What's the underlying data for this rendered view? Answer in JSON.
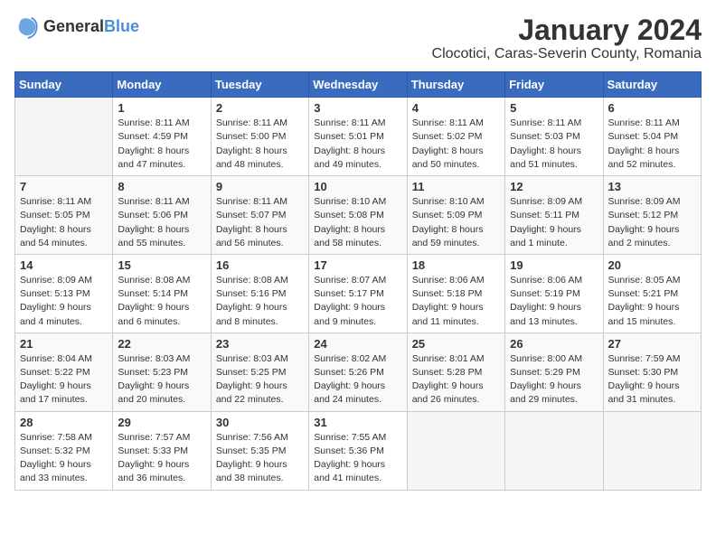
{
  "logo": {
    "general": "General",
    "blue": "Blue"
  },
  "header": {
    "month_year": "January 2024",
    "location": "Clocotici, Caras-Severin County, Romania"
  },
  "weekdays": [
    "Sunday",
    "Monday",
    "Tuesday",
    "Wednesday",
    "Thursday",
    "Friday",
    "Saturday"
  ],
  "weeks": [
    [
      {
        "day": "",
        "info": ""
      },
      {
        "day": "1",
        "info": "Sunrise: 8:11 AM\nSunset: 4:59 PM\nDaylight: 8 hours\nand 47 minutes."
      },
      {
        "day": "2",
        "info": "Sunrise: 8:11 AM\nSunset: 5:00 PM\nDaylight: 8 hours\nand 48 minutes."
      },
      {
        "day": "3",
        "info": "Sunrise: 8:11 AM\nSunset: 5:01 PM\nDaylight: 8 hours\nand 49 minutes."
      },
      {
        "day": "4",
        "info": "Sunrise: 8:11 AM\nSunset: 5:02 PM\nDaylight: 8 hours\nand 50 minutes."
      },
      {
        "day": "5",
        "info": "Sunrise: 8:11 AM\nSunset: 5:03 PM\nDaylight: 8 hours\nand 51 minutes."
      },
      {
        "day": "6",
        "info": "Sunrise: 8:11 AM\nSunset: 5:04 PM\nDaylight: 8 hours\nand 52 minutes."
      }
    ],
    [
      {
        "day": "7",
        "info": "Sunrise: 8:11 AM\nSunset: 5:05 PM\nDaylight: 8 hours\nand 54 minutes."
      },
      {
        "day": "8",
        "info": "Sunrise: 8:11 AM\nSunset: 5:06 PM\nDaylight: 8 hours\nand 55 minutes."
      },
      {
        "day": "9",
        "info": "Sunrise: 8:11 AM\nSunset: 5:07 PM\nDaylight: 8 hours\nand 56 minutes."
      },
      {
        "day": "10",
        "info": "Sunrise: 8:10 AM\nSunset: 5:08 PM\nDaylight: 8 hours\nand 58 minutes."
      },
      {
        "day": "11",
        "info": "Sunrise: 8:10 AM\nSunset: 5:09 PM\nDaylight: 8 hours\nand 59 minutes."
      },
      {
        "day": "12",
        "info": "Sunrise: 8:09 AM\nSunset: 5:11 PM\nDaylight: 9 hours\nand 1 minute."
      },
      {
        "day": "13",
        "info": "Sunrise: 8:09 AM\nSunset: 5:12 PM\nDaylight: 9 hours\nand 2 minutes."
      }
    ],
    [
      {
        "day": "14",
        "info": "Sunrise: 8:09 AM\nSunset: 5:13 PM\nDaylight: 9 hours\nand 4 minutes."
      },
      {
        "day": "15",
        "info": "Sunrise: 8:08 AM\nSunset: 5:14 PM\nDaylight: 9 hours\nand 6 minutes."
      },
      {
        "day": "16",
        "info": "Sunrise: 8:08 AM\nSunset: 5:16 PM\nDaylight: 9 hours\nand 8 minutes."
      },
      {
        "day": "17",
        "info": "Sunrise: 8:07 AM\nSunset: 5:17 PM\nDaylight: 9 hours\nand 9 minutes."
      },
      {
        "day": "18",
        "info": "Sunrise: 8:06 AM\nSunset: 5:18 PM\nDaylight: 9 hours\nand 11 minutes."
      },
      {
        "day": "19",
        "info": "Sunrise: 8:06 AM\nSunset: 5:19 PM\nDaylight: 9 hours\nand 13 minutes."
      },
      {
        "day": "20",
        "info": "Sunrise: 8:05 AM\nSunset: 5:21 PM\nDaylight: 9 hours\nand 15 minutes."
      }
    ],
    [
      {
        "day": "21",
        "info": "Sunrise: 8:04 AM\nSunset: 5:22 PM\nDaylight: 9 hours\nand 17 minutes."
      },
      {
        "day": "22",
        "info": "Sunrise: 8:03 AM\nSunset: 5:23 PM\nDaylight: 9 hours\nand 20 minutes."
      },
      {
        "day": "23",
        "info": "Sunrise: 8:03 AM\nSunset: 5:25 PM\nDaylight: 9 hours\nand 22 minutes."
      },
      {
        "day": "24",
        "info": "Sunrise: 8:02 AM\nSunset: 5:26 PM\nDaylight: 9 hours\nand 24 minutes."
      },
      {
        "day": "25",
        "info": "Sunrise: 8:01 AM\nSunset: 5:28 PM\nDaylight: 9 hours\nand 26 minutes."
      },
      {
        "day": "26",
        "info": "Sunrise: 8:00 AM\nSunset: 5:29 PM\nDaylight: 9 hours\nand 29 minutes."
      },
      {
        "day": "27",
        "info": "Sunrise: 7:59 AM\nSunset: 5:30 PM\nDaylight: 9 hours\nand 31 minutes."
      }
    ],
    [
      {
        "day": "28",
        "info": "Sunrise: 7:58 AM\nSunset: 5:32 PM\nDaylight: 9 hours\nand 33 minutes."
      },
      {
        "day": "29",
        "info": "Sunrise: 7:57 AM\nSunset: 5:33 PM\nDaylight: 9 hours\nand 36 minutes."
      },
      {
        "day": "30",
        "info": "Sunrise: 7:56 AM\nSunset: 5:35 PM\nDaylight: 9 hours\nand 38 minutes."
      },
      {
        "day": "31",
        "info": "Sunrise: 7:55 AM\nSunset: 5:36 PM\nDaylight: 9 hours\nand 41 minutes."
      },
      {
        "day": "",
        "info": ""
      },
      {
        "day": "",
        "info": ""
      },
      {
        "day": "",
        "info": ""
      }
    ]
  ]
}
